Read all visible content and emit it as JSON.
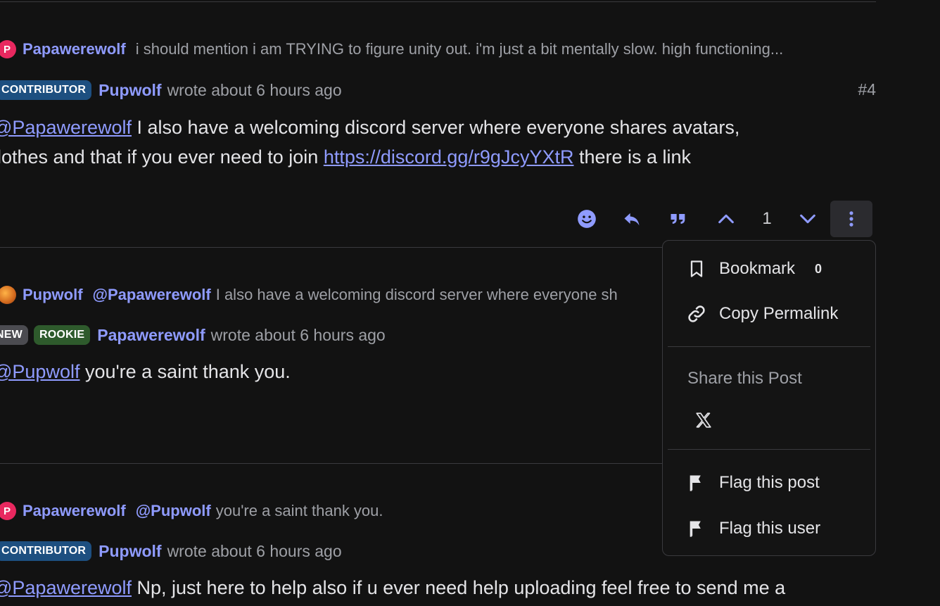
{
  "post4": {
    "reply_to": {
      "avatar_letter": "P",
      "user": "Papawerewolf",
      "excerpt": "i should mention i am TRYING to figure unity out. i'm just a bit mentally slow. high functioning..."
    },
    "badge": "CONTRIBUTOR",
    "author": "Pupwolf",
    "time": "wrote about 6 hours ago",
    "number": "#4",
    "mention": "@Papawerewolf",
    "line1_rest": " I also have a welcoming discord server where everyone shares avatars,",
    "line2_start": "lothes and that if you ever need to join ",
    "link": "https://discord.gg/r9gJcyYXtR",
    "line2_end": " there is a link"
  },
  "actions": {
    "vote_count": "1"
  },
  "post5": {
    "reply_to": {
      "user": "Pupwolf",
      "mention": "@Papawerewolf",
      "excerpt": "I also have a welcoming discord server where everyone sh"
    },
    "badges": [
      "NEW",
      "ROOKIE"
    ],
    "author": "Papawerewolf",
    "time": "wrote about 6 hours ago",
    "mention": "@Pupwolf",
    "text": " you're a saint thank you."
  },
  "post6": {
    "reply_to": {
      "avatar_letter": "P",
      "user": "Papawerewolf",
      "mention": "@Pupwolf",
      "excerpt": "you're a saint thank you."
    },
    "badge": "CONTRIBUTOR",
    "author": "Pupwolf",
    "time": "wrote about 6 hours ago",
    "mention": "@Papawerewolf",
    "text": " Np, just here to help also if u ever need help uploading feel free to send me a"
  },
  "menu": {
    "bookmark_label": "Bookmark",
    "bookmark_count": "0",
    "copy_label": "Copy Permalink",
    "share_label": "Share this Post",
    "flag_post_label": "Flag this post",
    "flag_user_label": "Flag this user"
  },
  "colors": {
    "background": "#121212",
    "accent": "#8f9bff",
    "contributor_badge": "#1d4f80",
    "rookie_badge": "#2e5a2c",
    "new_badge": "#4b4b50"
  }
}
